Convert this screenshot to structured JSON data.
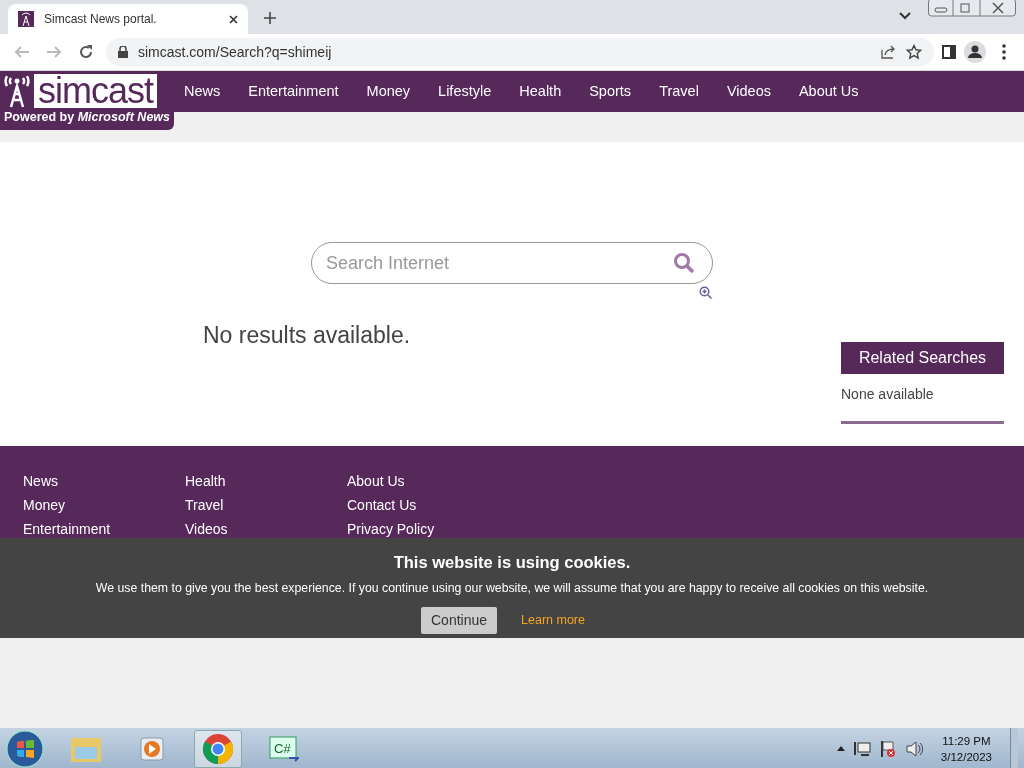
{
  "browser": {
    "tab_title": "Simcast News portal.",
    "url": "simcast.com/Search?q=shimeij"
  },
  "site": {
    "logo": "simcast",
    "tagline": "Powered by *Microsoft News*",
    "nav": [
      "News",
      "Entertainment",
      "Money",
      "Lifestyle",
      "Health",
      "Sports",
      "Travel",
      "Videos",
      "About Us"
    ]
  },
  "search": {
    "placeholder": "Search Internet"
  },
  "results": {
    "message": "No results available."
  },
  "related": {
    "title": "Related Searches",
    "text": "None available"
  },
  "footer": {
    "columns": [
      [
        "News",
        "Money",
        "Entertainment"
      ],
      [
        "Health",
        "Travel",
        "Videos"
      ],
      [
        "About Us",
        "Contact Us",
        "Privacy Policy"
      ]
    ]
  },
  "cookies": {
    "title": "This website is using cookies.",
    "text": "We use them to give you the best experience. If you continue using our website, we will assume that you are happy to receive all cookies on this website.",
    "button": "Continue",
    "link": "Learn more"
  },
  "taskbar": {
    "app_label": "C#",
    "time": "11:29 PM",
    "date": "3/12/2023"
  }
}
